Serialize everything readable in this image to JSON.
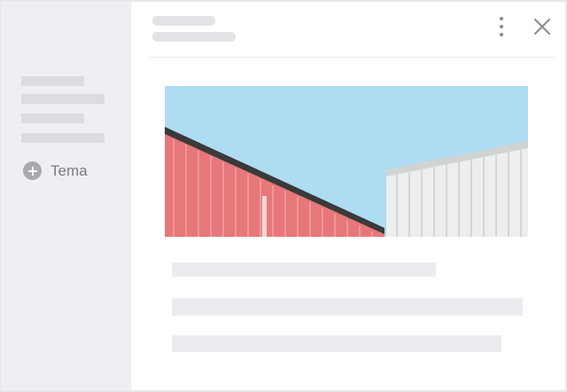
{
  "sidebar": {
    "add_topic": {
      "icon": "plus-circle-icon",
      "label": "Tema"
    }
  },
  "header": {
    "more_icon": "more-vertical-icon",
    "close_icon": "close-icon"
  },
  "content": {
    "image": "photo-red-and-white-corrugated-buildings-blue-sky"
  },
  "colors": {
    "sidebar_bg": "#efeff3",
    "skeleton": "#dcdce0",
    "icon_gray": "#8a8a8f",
    "sky": "#aedcf2",
    "red_wall": "#e7777a",
    "white_wall": "#ecefee"
  }
}
